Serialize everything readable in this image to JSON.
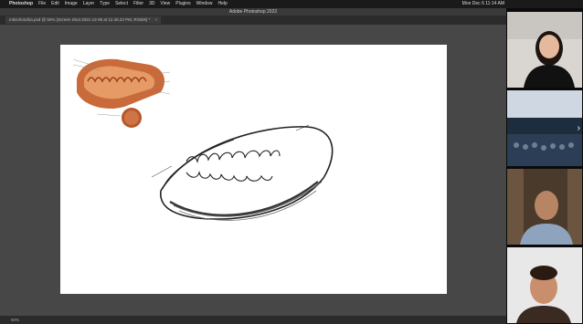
{
  "menubar": {
    "app": "Photoshop",
    "menus": [
      "File",
      "Edit",
      "Image",
      "Layer",
      "Type",
      "Select",
      "Filter",
      "3D",
      "View",
      "Plugins",
      "Window",
      "Help"
    ],
    "clock": "Mon Dec 6  11:14 AM",
    "apple_icon": "apple-icon"
  },
  "ps": {
    "window_title": "Adobe Photoshop 2022",
    "tab": "mitochondria.psd @ 50% (Screen Shot 2021-12-06 at 12.45.22 PM, RGB/8) *",
    "tab_close": "×",
    "status_zoom": "50%"
  },
  "video": {
    "participants": [
      "participant-1",
      "participant-2",
      "participant-3",
      "participant-4"
    ],
    "next_glyph": "›"
  },
  "colors": {
    "accent": "#c86a3a",
    "canvas": "#ffffff"
  }
}
